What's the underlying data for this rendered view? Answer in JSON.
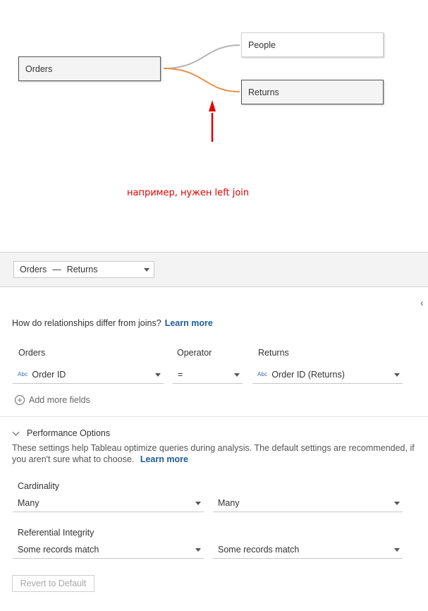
{
  "canvas": {
    "root_table": "Orders",
    "related_tables": [
      "People",
      "Returns"
    ],
    "annotation": "например, нужен left join",
    "colors": {
      "link_gray": "#b3b3b3",
      "link_active": "#e8904a",
      "arrow": "#e00000"
    }
  },
  "relationship": {
    "selector": {
      "left": "Orders",
      "separator": "—",
      "right": "Returns"
    },
    "help_text": "How do relationships differ from joins?",
    "help_link": "Learn more",
    "columns": {
      "left": "Orders",
      "operator": "Operator",
      "right": "Returns"
    },
    "left_field": {
      "type_icon": "Abc",
      "value": "Order ID"
    },
    "operator_value": "=",
    "right_field": {
      "type_icon": "Abc",
      "value": "Order ID (Returns)"
    },
    "add_fields": "Add more fields"
  },
  "performance": {
    "title": "Performance Options",
    "description": "These settings help Tableau optimize queries during analysis. The default settings are recommended, if you aren't sure what to choose.",
    "learn_more": "Learn more",
    "cardinality_label": "Cardinality",
    "cardinality_left": "Many",
    "cardinality_right": "Many",
    "integrity_label": "Referential Integrity",
    "integrity_left": "Some records match",
    "integrity_right": "Some records match",
    "revert_label": "Revert to Default"
  }
}
